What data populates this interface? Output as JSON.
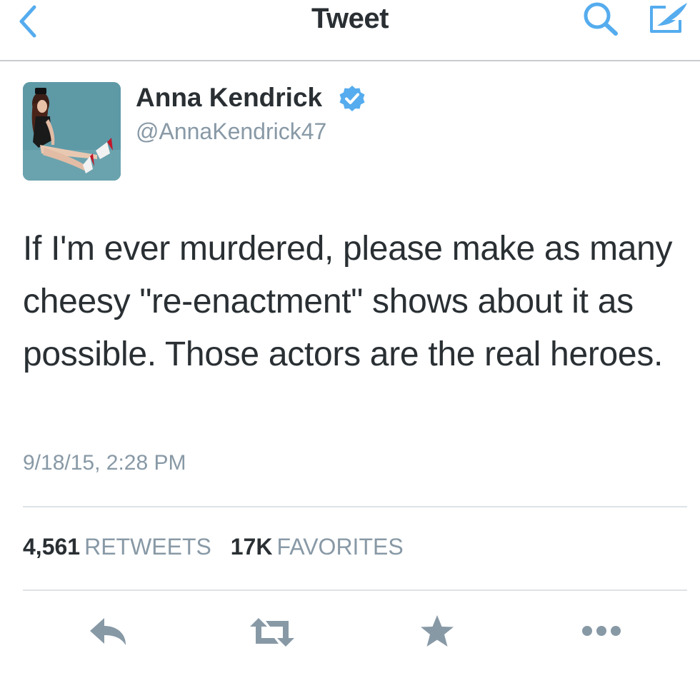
{
  "navbar": {
    "title": "Tweet",
    "back_icon": "chevron-left-icon",
    "search_icon": "search-icon",
    "compose_icon": "compose-icon",
    "accent_color": "#55acee"
  },
  "tweet": {
    "display_name": "Anna Kendrick",
    "verified": true,
    "handle": "@AnnaKendrick47",
    "text": "If I'm ever murdered, please make as many cheesy \"re-enactment\" shows about it as possible. Those actors are the real heroes.",
    "timestamp": "9/18/15, 2:28 PM"
  },
  "stats": {
    "retweets_count": "4,561",
    "retweets_label": "RETWEETS",
    "favorites_count": "17K",
    "favorites_label": "FAVORITES"
  },
  "actions": [
    "reply-icon",
    "retweet-icon",
    "favorite-star-icon",
    "more-dots-icon"
  ],
  "colors": {
    "text": "#292f33",
    "muted": "#8899a6",
    "icon_gray": "#8899a6",
    "verified": "#55acee"
  }
}
